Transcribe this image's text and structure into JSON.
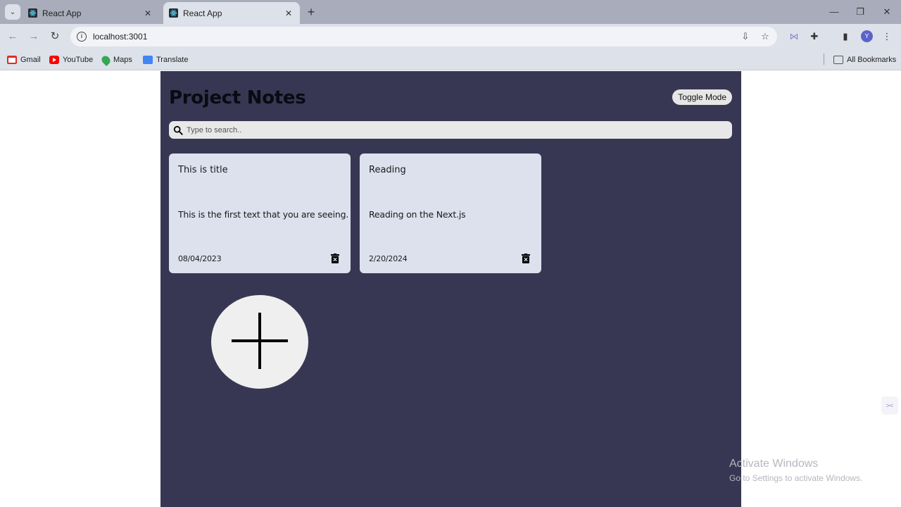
{
  "browser": {
    "tabs": [
      {
        "title": "React App",
        "active": false
      },
      {
        "title": "React App",
        "active": true
      }
    ],
    "url": "localhost:3001",
    "profile_initial": "Y",
    "bookmarks": [
      {
        "label": "Gmail",
        "icon": "gmail-icon",
        "color": "#d93025"
      },
      {
        "label": "YouTube",
        "icon": "youtube-icon",
        "color": "#ff0000"
      },
      {
        "label": "Maps",
        "icon": "maps-icon",
        "color": "#34a853"
      },
      {
        "label": "Translate",
        "icon": "translate-icon",
        "color": "#4285f4"
      }
    ],
    "all_bookmarks_label": "All Bookmarks"
  },
  "app": {
    "title": "Project Notes",
    "toggle_label": "Toggle Mode",
    "search_placeholder": "Type to search..",
    "background": "#383753",
    "notes": [
      {
        "title": "This is title",
        "text": "This is the first text that you are seeing.",
        "date": "08/04/2023"
      },
      {
        "title": "Reading",
        "text": "Reading on the Next.js",
        "date": "2/20/2024"
      }
    ]
  },
  "overlay": {
    "activate_title": "Activate Windows",
    "activate_sub": "Go to Settings to activate Windows."
  }
}
